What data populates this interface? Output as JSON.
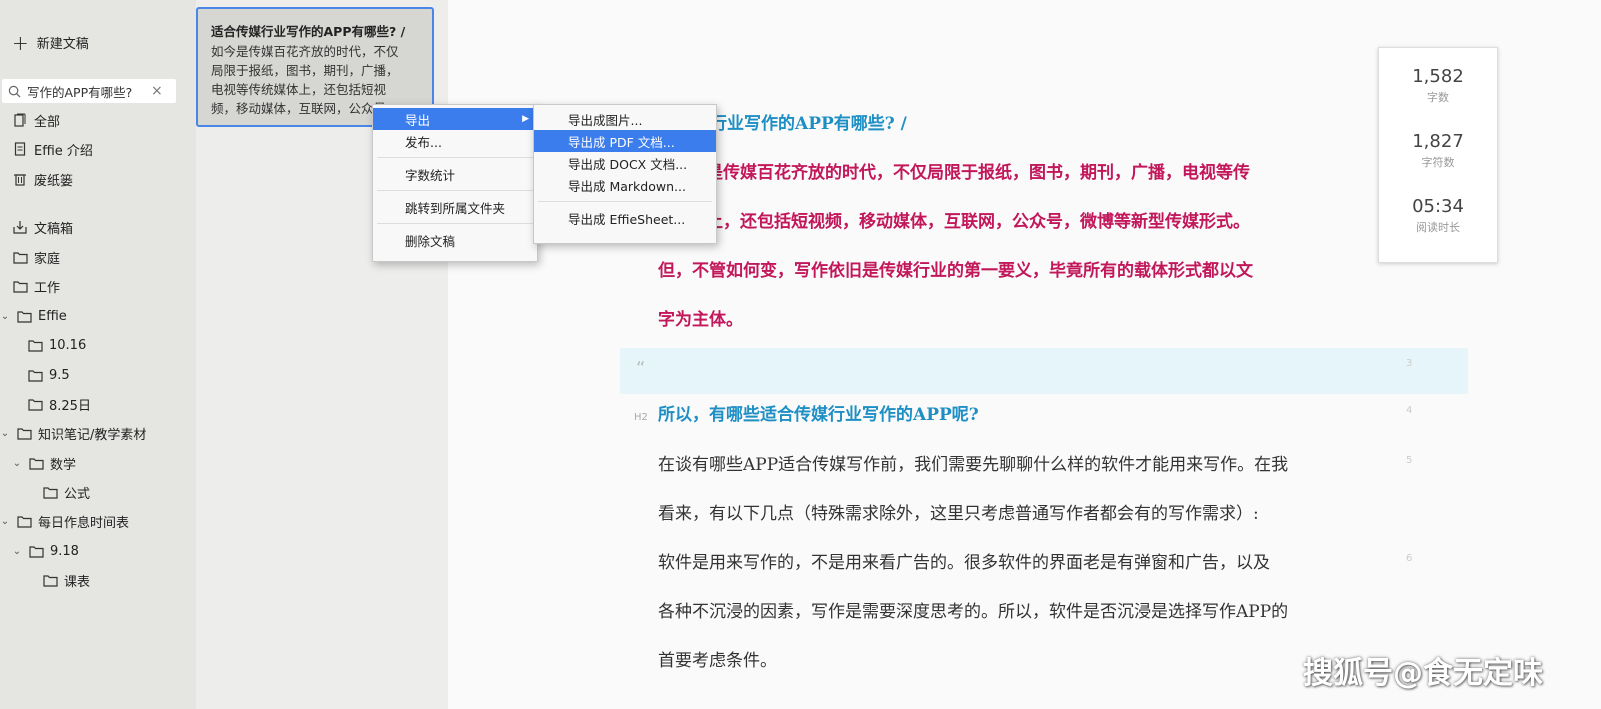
{
  "sidebar": {
    "new_doc": "新建文稿",
    "search_value": "写作的APP有哪些?",
    "items": [
      {
        "label": "全部",
        "icon": "library-icon"
      },
      {
        "label": "Effie 介绍",
        "icon": "document-icon"
      },
      {
        "label": "废纸篓",
        "icon": "trash-icon"
      },
      {
        "label": "文稿箱",
        "icon": "inbox-icon"
      },
      {
        "label": "家庭",
        "icon": "folder-icon"
      },
      {
        "label": "工作",
        "icon": "folder-icon"
      },
      {
        "label": "Effie",
        "icon": "folder-icon"
      },
      {
        "label": "10.16",
        "icon": "folder-icon"
      },
      {
        "label": "9.5",
        "icon": "folder-icon"
      },
      {
        "label": "8.25日",
        "icon": "folder-icon"
      },
      {
        "label": "知识笔记/教学素材",
        "icon": "folder-icon"
      },
      {
        "label": "数学",
        "icon": "folder-icon"
      },
      {
        "label": "公式",
        "icon": "folder-icon"
      },
      {
        "label": "每日作息时间表",
        "icon": "folder-icon"
      },
      {
        "label": "9.18",
        "icon": "folder-icon"
      },
      {
        "label": "课表",
        "icon": "folder-icon"
      }
    ]
  },
  "doc_card": {
    "title": "适合传媒行业写作的APP有哪些? /",
    "excerpt": [
      "如今是传媒百花齐放的时代，不仅",
      "局限于报纸，图书，期刊，广播，",
      "电视等传统媒体上，还包括短视",
      "频，移动媒体，互联网，公众号..."
    ]
  },
  "context_menu": {
    "items": [
      "导出",
      "发布...",
      "字数统计",
      "跳转到所属文件夹",
      "删除文稿"
    ]
  },
  "export_submenu": {
    "items": [
      "导出成图片...",
      "导出成 PDF 文档...",
      "导出成 DOCX 文档...",
      "导出成 Markdown...",
      "导出成 EffieSheet..."
    ]
  },
  "editor": {
    "title_line": "传媒行业写作的APP有哪些? /",
    "p1_line1": "是传媒百花齐放的时代，不仅局限于报纸，图书，期刊，广播，电视等传",
    "p1_line2": "上，还包括短视频，移动媒体，互联网，公众号，微博等新型传媒形式。",
    "p1_line3": "但，不管如何变，写作依旧是传媒行业的第一要义，毕竟所有的载体形式都以文",
    "p1_line4": "字为主体。",
    "quote_mark": "“",
    "h2_tag": "H2",
    "heading": "所以，有哪些适合传媒行业写作的APP呢?",
    "p2_line1": "在谈有哪些APP适合传媒写作前，我们需要先聊聊什么样的软件才能用来写作。在我",
    "p2_line2": "看来，有以下几点（特殊需求除外，这里只考虑普通写作者都会有的写作需求）:",
    "p3_line1": "   软件是用来写作的，不是用来看广告的。很多软件的界面老是有弹窗和广告，以及",
    "p3_line2": "各种不沉浸的因素，写作是需要深度思考的。所以，软件是否沉浸是选择写作APP的",
    "p3_line3": "首要考虑条件。",
    "line_numbers": [
      "3",
      "4",
      "5",
      "6"
    ]
  },
  "stats": {
    "words_value": "1,582",
    "words_label": "字数",
    "chars_value": "1,827",
    "chars_label": "字符数",
    "time_value": "05:34",
    "time_label": "阅读时长"
  },
  "watermark": "搜狐号@食无定味",
  "colors": {
    "accent": "#3b7ded",
    "pink_text": "#c2185b",
    "blue_heading": "#1e8fc4"
  }
}
